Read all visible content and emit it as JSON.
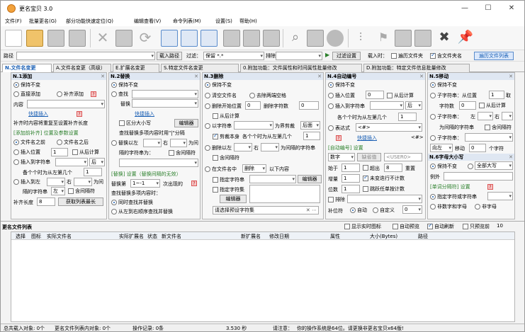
{
  "title": "更名宝贝 3.0",
  "window_controls": {
    "minimize": "—",
    "maximize": "☐",
    "close": "✕"
  },
  "menu": [
    "文件(F)",
    "批量更名(G)",
    "部分功能快速定位(Q)",
    "编辑查看(V)",
    "命令列表(M)",
    "设置(S)",
    "帮助(H)"
  ],
  "pathbar": {
    "path_label": "路径",
    "load_btn": "载入路径",
    "filter_label": "过滤：",
    "filter_value": "保留 *.*",
    "exclude_label": "排除",
    "filter_run": "过滤设置",
    "load_time_label": "载入时：",
    "opt_subfolder": "遍历文件夹",
    "opt_hidden": "含文件夹名",
    "file_list_btn": "遍历文件列表"
  },
  "tabs": [
    "N.文件名变更",
    "A.文件名变更（高级）",
    "E.扩展名变更",
    "S.特定文件名变更",
    "0.附加功能：文件属性和时间属性批量修改",
    "D.附加功能：特定文件信息批量修改"
  ],
  "p1": {
    "title": "N.1添加",
    "keep": "保持不变",
    "direct": "直接添加",
    "pad": "补齐添加",
    "content_label": "内容",
    "quick_insert": "快捷插入",
    "seq_note": "补齐时内容将重复至设置补齐长度",
    "sub_title": "[添加前补齐] 位置及参数设置",
    "before_name": "文件名之前",
    "after_name": "文件名之后",
    "insert_pos": "插入位置",
    "from_right": "从后计算",
    "insert_str": "插入到字符串",
    "after_opt": "后",
    "count_note": "备个个时为从左第几个",
    "insert_left": "插入到左",
    "right_opt": "右",
    "as_opt": "为间",
    "between_label": "隔的字符串",
    "right_match": "左",
    "contain": "含间隔符",
    "pad_len_label": "补齐长度",
    "pad_len_val": "8",
    "get_max_btn": "获取列表最长"
  },
  "p2": {
    "title": "N.2替换",
    "keep": "保持不变",
    "find_label": "查找",
    "replace_label": "替换",
    "quick_insert": "快捷插入",
    "case_sens": "区分大小写",
    "editor": "编辑器",
    "note": "查找替换多项内容时用\"|\"分隔",
    "replace_left": "替换以左",
    "right_opt": "右",
    "as_opt": "为间",
    "between_label": "隔的字符串为：",
    "contain": "含间隔符",
    "sub_title": "[替换] 设置（替换间隔的无效）",
    "replace_count_label": "替换第",
    "replace_count_val": "1~-1",
    "replace_count_suffix": "次出现的",
    "multi_note": "查找替换多项内容时：",
    "opt_simul": "同时查找并替换",
    "opt_order": "从左到右顺序查找并替换"
  },
  "p3": {
    "title": "N.3删除",
    "keep": "保持不变",
    "clear": "清空文件名",
    "trim": "去除两端空格",
    "del_from": "删除开始位置",
    "del_count_label": "删除字符数",
    "from_right": "从后计算",
    "by_str": "以字符串",
    "right_opt": "为界剪裁",
    "after_opt": "后面",
    "cut_self": "剪裁本身",
    "count_note": "各个个时为从左第几个",
    "del_left": "删除以左",
    "right2": "右",
    "between": "为间隔的字符串",
    "contain": "含间隔符",
    "in_name": "在文件名中",
    "del_opt": "删除",
    "below": "以下内容",
    "spec_str": "指定字符串",
    "editor": "编辑器",
    "spec_set": "指定字符集",
    "editor2": "编辑器",
    "preset_label": "请选择预设字符集"
  },
  "p4": {
    "title": "N.4自动编号",
    "keep": "保持不变",
    "insert_pos": "插入位置",
    "insert_pos_val": "0",
    "from_right": "从后计算",
    "insert_str": "插入到字符串",
    "after_opt": "后",
    "count_note": "各个个时为从左第几个",
    "expr": "表达式",
    "expr_val": "<#>",
    "quick_insert": "快捷插入",
    "var_label": "<#>",
    "sub_title": "[自动编号] 设置",
    "num_label": "数字",
    "sys_val": "缺省值",
    "usr_val": "<USER0>",
    "start_label": "始于",
    "start_val": "1",
    "width_label": "超出",
    "width_val": "8",
    "dup": "重置",
    "step_label": "增量",
    "step_val": "1",
    "unchanged": "未变迭行不计数",
    "digits_label": "位数",
    "digits_val": "1",
    "skip": "跳跃任单按计数",
    "exclude_label": "排除",
    "pad_label": "补位符",
    "pad_auto": "自动",
    "pad_custom": "自定义",
    "pad_val": "0"
  },
  "p5": {
    "title": "N.5移动",
    "keep": "保持不变",
    "sub_from": "子字符串：从位置",
    "sub_from_val": "1",
    "take_label": "取",
    "char_count": "字符数",
    "char_count_val": "0",
    "from_right": "从后计算",
    "sub_str": "子字符串：",
    "left_opt": "左",
    "right_opt": "右",
    "between_label": "为间隔的字符串",
    "contain": "含间隔符",
    "sub_str2": "子字符串：",
    "dir_val": "向左",
    "move_label": "移动",
    "move_val": "0",
    "char_unit": "个字符",
    "case_title": "N.6字母大小写",
    "case_keep": "保持不变",
    "case_all": "全部大写",
    "exception_label": "例外",
    "word_title": "[单词分隔符] 设置",
    "word_spec": "指定字符或字符串",
    "word_space": "非数字和字母",
    "word_pref": "非字母"
  },
  "files": {
    "title": "更名文件列表",
    "opt_realtime": "显示实时图标",
    "opt_autopreview": "自动预览",
    "opt_autorefresh": "自动刷新",
    "opt_onlyshow": "只预览前",
    "onlyshow_val": "10",
    "columns": [
      "选择",
      "图标",
      "实际文件名",
      "实际扩展名",
      "状态",
      "新文件名",
      "新扩展名",
      "修改日期",
      "属性",
      "大小(Bytes)",
      "路径"
    ]
  },
  "status": {
    "total": "总共载入对象: 0个",
    "changed": "更名文件列表内对象: 0个",
    "ops": "操作记录: 0条",
    "time": "3.530 秒",
    "tip_label": "请注意：",
    "tip": "你的操作系统是64位。请更换非更名宝贝x64版!"
  }
}
